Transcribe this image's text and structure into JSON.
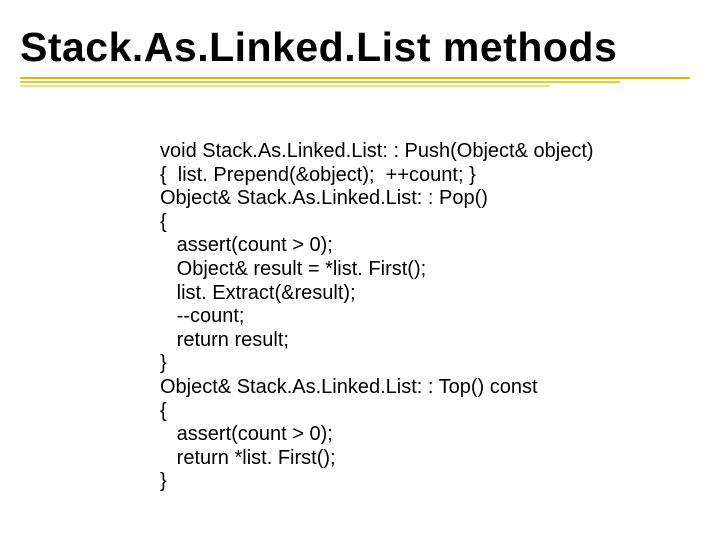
{
  "title": "Stack.As.Linked.List methods",
  "code": {
    "l0": "void Stack.As.Linked.List: : Push(Object& object)",
    "l1": "{  list. Prepend(&object);  ++count; }",
    "l2": "Object& Stack.As.Linked.List: : Pop()",
    "l3": "{",
    "l4": "   assert(count > 0);",
    "l5": "   Object& result = *list. First();",
    "l6": "   list. Extract(&result);",
    "l7": "   --count;",
    "l8": "   return result;",
    "l9": "}",
    "l10": "Object& Stack.As.Linked.List: : Top() const",
    "l11": "{",
    "l12": "   assert(count > 0);",
    "l13": "   return *list. First();",
    "l14": "}"
  }
}
